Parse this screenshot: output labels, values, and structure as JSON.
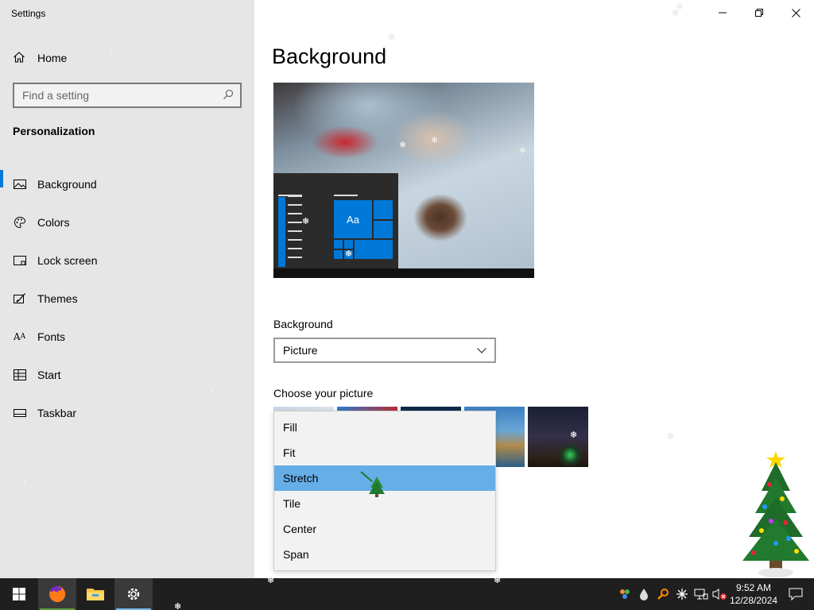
{
  "window": {
    "title": "Settings"
  },
  "sidebar": {
    "home_label": "Home",
    "search_placeholder": "Find a setting",
    "section_title": "Personalization",
    "items": [
      {
        "label": "Background",
        "icon": "picture-icon"
      },
      {
        "label": "Colors",
        "icon": "palette-icon"
      },
      {
        "label": "Lock screen",
        "icon": "lock-screen-icon"
      },
      {
        "label": "Themes",
        "icon": "brush-icon"
      },
      {
        "label": "Fonts",
        "icon": "font-icon"
      },
      {
        "label": "Start",
        "icon": "start-icon"
      },
      {
        "label": "Taskbar",
        "icon": "taskbar-icon"
      }
    ]
  },
  "main": {
    "title": "Background",
    "preview_tile_text": "Aa",
    "background_label": "Background",
    "background_value": "Picture",
    "choose_label": "Choose your picture",
    "fit_options": [
      "Fill",
      "Fit",
      "Stretch",
      "Tile",
      "Center",
      "Span"
    ],
    "fit_hovered": "Stretch"
  },
  "taskbar": {
    "time": "9:52 AM",
    "date": "12/28/2024",
    "pinned": [
      "firefox-icon",
      "file-explorer-icon",
      "settings-icon"
    ]
  },
  "colors": {
    "accent": "#0078d7",
    "hover": "#65aee8",
    "sidebar_bg": "#e6e6e6",
    "taskbar_bg": "#1f1f1f"
  }
}
